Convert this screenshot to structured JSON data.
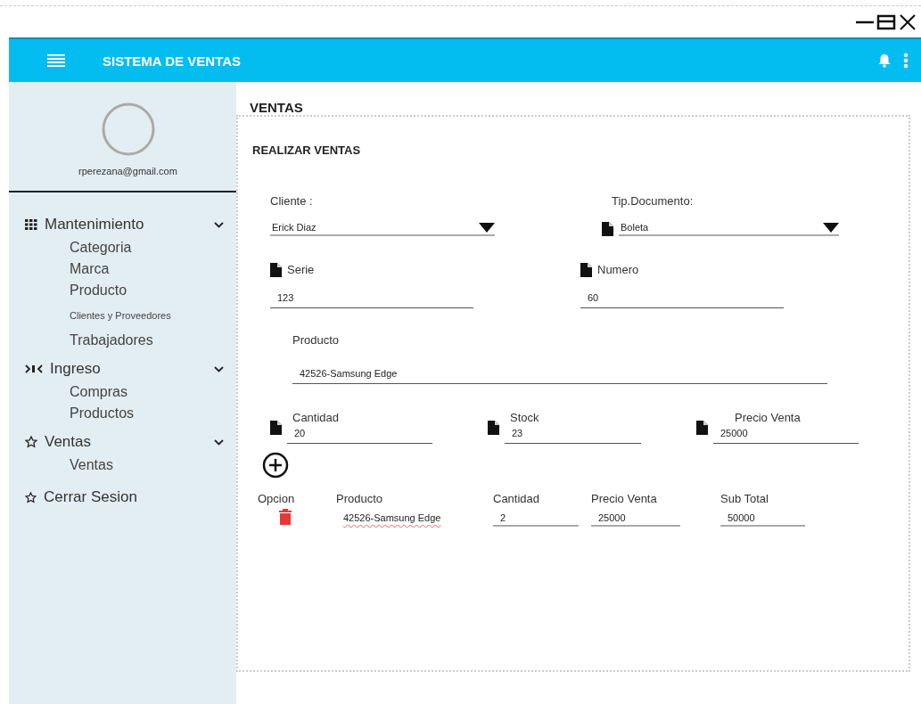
{
  "app_bar": {
    "title": "SISTEMA DE VENTAS"
  },
  "sidebar": {
    "email": "rperezana@gmail.com",
    "groups": [
      {
        "label": "Mantenimiento",
        "expanded": true,
        "items": [
          "Categoria",
          "Marca",
          "Producto",
          "Clientes y Proveedores",
          "Trabajadores"
        ]
      },
      {
        "label": "Ingreso",
        "expanded": true,
        "items": [
          "Compras",
          "Productos"
        ]
      },
      {
        "label": "Ventas",
        "expanded": true,
        "items": [
          "Ventas"
        ]
      }
    ],
    "logout": "Cerrar Sesion"
  },
  "page_title": "VENTAS",
  "card": {
    "title": "REALIZAR VENTAS",
    "rows": [
      [
        {
          "label": "Cliente :",
          "value": "Erick Diaz",
          "kind": "select",
          "icon": false
        },
        {
          "label": "Tip.Documento:",
          "value": "Boleta",
          "kind": "select",
          "icon": true
        }
      ],
      [
        {
          "label": "Serie",
          "value": "123",
          "kind": "text",
          "icon": true
        },
        {
          "label": "Numero",
          "value": "60",
          "kind": "text",
          "icon": true
        }
      ],
      [
        {
          "label": "Producto",
          "value": "42526-Samsung Edge",
          "kind": "text",
          "icon": false
        }
      ],
      [
        {
          "label": "Cantidad",
          "value": "20",
          "kind": "text",
          "icon": true
        },
        {
          "label": "Stock",
          "value": "23",
          "kind": "text",
          "icon": true
        },
        {
          "label": "Precio Venta",
          "value": "25000",
          "kind": "text",
          "icon": true
        }
      ]
    ],
    "table": {
      "columns": [
        "Opcion",
        "Producto",
        "Cantidad",
        "Precio Venta",
        "Sub Total"
      ],
      "rows": [
        {
          "product": "42526-Samsung Edge",
          "quantity": "2",
          "price": "25000",
          "subtotal": "50000"
        }
      ]
    }
  }
}
